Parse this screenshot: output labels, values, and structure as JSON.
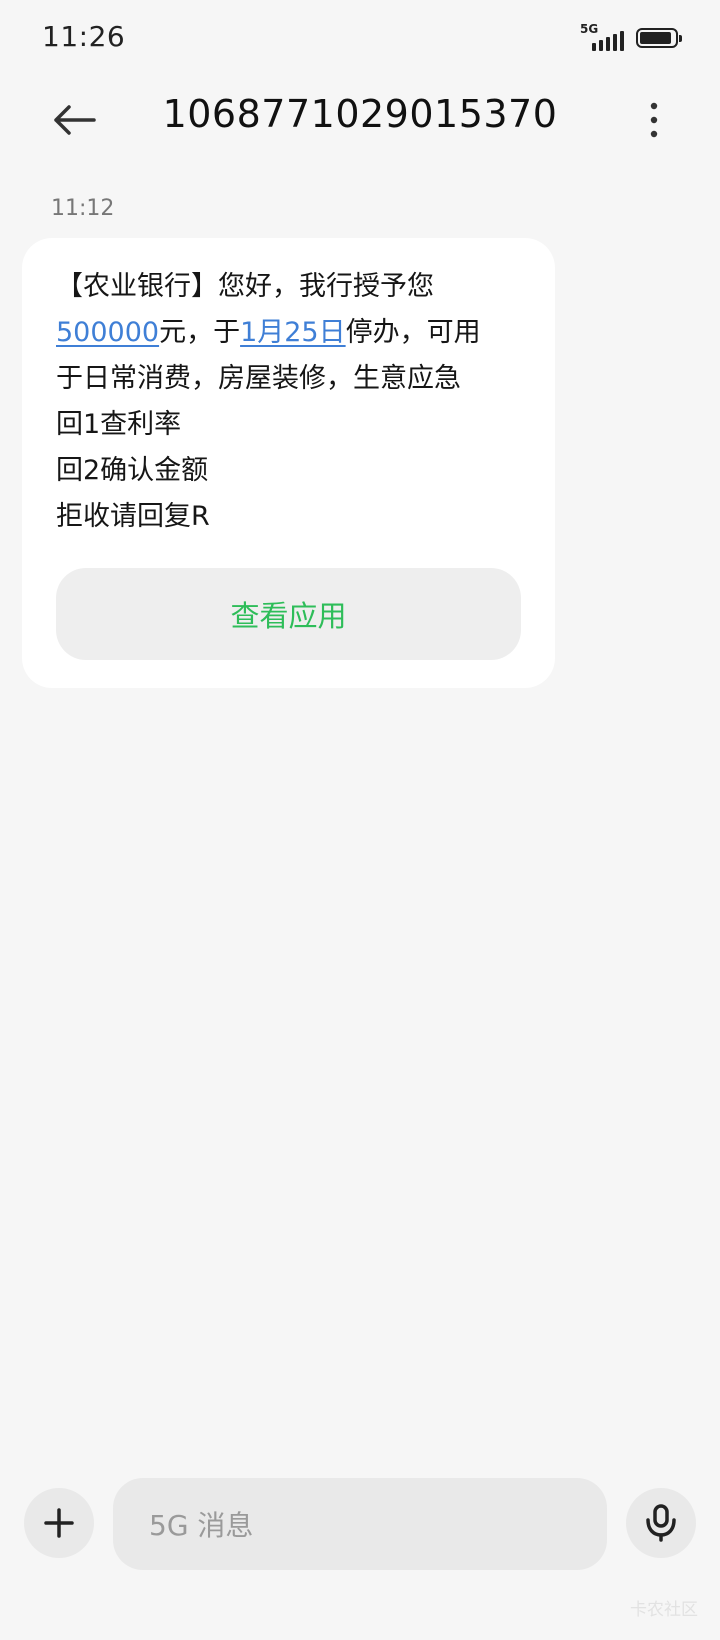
{
  "status_bar": {
    "time": "11:26",
    "network": "5G",
    "battery_level": 0.9
  },
  "header": {
    "title": "1068771029015370",
    "back_icon": "arrow-left-icon",
    "more_icon": "more-vertical-icon"
  },
  "message": {
    "time": "11:12",
    "segments": {
      "s1": "【农业银行】您好，我行授予您\n",
      "link_amount": "500000",
      "s2": "元，于",
      "link_date": "1月25日",
      "s3": "停办，可用\n于日常消费，房屋装修，生意应急\n回1查利率\n回2确认金额\n拒收请回复R"
    },
    "action_label": "查看应用",
    "link_color": "#3f7fd6",
    "action_color": "#2ebd59"
  },
  "input_bar": {
    "add_icon": "plus-icon",
    "placeholder": "5G 消息",
    "voice_icon": "microphone-icon"
  },
  "watermark": "卡农社区"
}
